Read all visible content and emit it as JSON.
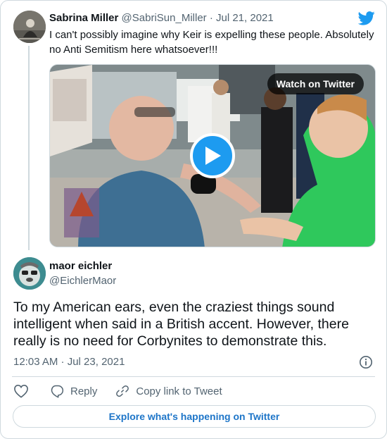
{
  "parent_tweet": {
    "author_name": "Sabrina Miller",
    "author_handle": "@SabriSun_Miller",
    "separator": "·",
    "date": "Jul 21, 2021",
    "text": "I can't possibly imagine why Keir is expelling these people. Absolutely no Anti Semitism here whatsoever!!!",
    "media": {
      "watch_label": "Watch on Twitter",
      "play_icon": "play-icon"
    }
  },
  "main_tweet": {
    "author_name": "maor eichler",
    "author_handle": "@EichlerMaor",
    "text": "To my American ears, even the craziest things sound intelligent when said in a British accent. However, there really is no need for Corbynites to demonstrate this.",
    "timestamp": "12:03 AM · Jul 23, 2021"
  },
  "actions": {
    "like_icon": "heart-icon",
    "reply_label": "Reply",
    "copy_link_label": "Copy link to Tweet"
  },
  "explore_label": "Explore what's happening on Twitter",
  "colors": {
    "twitter_blue": "#1d9bf0",
    "link_blue": "#1d75c8",
    "text_primary": "#0f1419",
    "text_secondary": "#536471",
    "border": "#cfd9de"
  }
}
